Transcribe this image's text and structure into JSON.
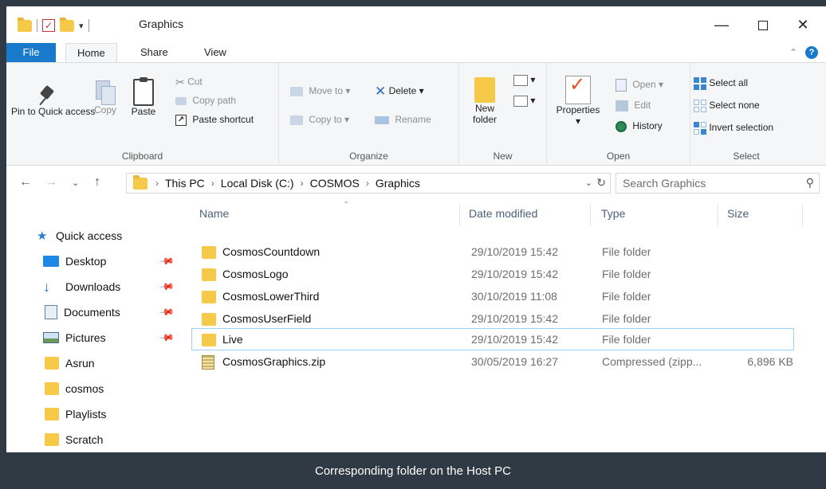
{
  "window": {
    "title": "Graphics"
  },
  "window_controls": {
    "minimize": "—",
    "close": "✕"
  },
  "ribbon_tabs": {
    "file": "File",
    "home": "Home",
    "share": "Share",
    "view": "View"
  },
  "ribbon": {
    "clipboard": {
      "label": "Clipboard",
      "pin": "Pin to Quick access",
      "copy": "Copy",
      "paste": "Paste",
      "cut": "Cut",
      "copy_path": "Copy path",
      "paste_shortcut": "Paste shortcut"
    },
    "organize": {
      "label": "Organize",
      "move_to": "Move to",
      "delete": "Delete",
      "copy_to": "Copy to",
      "rename": "Rename"
    },
    "new": {
      "label": "New",
      "new_folder": "New folder"
    },
    "open": {
      "label": "Open",
      "properties": "Properties",
      "open": "Open",
      "edit": "Edit",
      "history": "History"
    },
    "select": {
      "label": "Select",
      "select_all": "Select all",
      "select_none": "Select none",
      "invert_selection": "Invert selection"
    }
  },
  "address": {
    "breadcrumbs": [
      "This PC",
      "Local Disk (C:)",
      "COSMOS",
      "Graphics"
    ]
  },
  "search": {
    "placeholder": "Search Graphics"
  },
  "nav": {
    "quick_access": "Quick access",
    "items": [
      {
        "label": "Desktop",
        "icon": "desktop-icon",
        "pinned": true
      },
      {
        "label": "Downloads",
        "icon": "downloads-icon",
        "pinned": true
      },
      {
        "label": "Documents",
        "icon": "documents-icon",
        "pinned": true
      },
      {
        "label": "Pictures",
        "icon": "pictures-icon",
        "pinned": true
      },
      {
        "label": "Asrun",
        "icon": "folder-icon",
        "pinned": false
      },
      {
        "label": "cosmos",
        "icon": "folder-icon",
        "pinned": false
      },
      {
        "label": "Playlists",
        "icon": "folder-icon",
        "pinned": false
      },
      {
        "label": "Scratch",
        "icon": "folder-icon",
        "pinned": false
      }
    ]
  },
  "columns": {
    "name": "Name",
    "date": "Date modified",
    "type": "Type",
    "size": "Size"
  },
  "files": [
    {
      "name": "CosmosCountdown",
      "date": "29/10/2019 15:42",
      "type": "File folder",
      "size": "",
      "icon": "folder-icon"
    },
    {
      "name": "CosmosLogo",
      "date": "29/10/2019 15:42",
      "type": "File folder",
      "size": "",
      "icon": "folder-icon"
    },
    {
      "name": "CosmosLowerThird",
      "date": "30/10/2019 11:08",
      "type": "File folder",
      "size": "",
      "icon": "folder-icon"
    },
    {
      "name": "CosmosUserField",
      "date": "29/10/2019 15:42",
      "type": "File folder",
      "size": "",
      "icon": "folder-icon"
    },
    {
      "name": "Live",
      "date": "29/10/2019 15:42",
      "type": "File folder",
      "size": "",
      "icon": "folder-icon",
      "selected": true
    },
    {
      "name": "CosmosGraphics.zip",
      "date": "30/05/2019 16:27",
      "type": "Compressed (zipp...",
      "size": "6,896 KB",
      "icon": "zip-icon"
    }
  ],
  "caption": "Corresponding folder on the Host PC",
  "colors": {
    "accent": "#1979ca",
    "folder": "#f7c948",
    "frame": "#2f3a45",
    "selection_border": "#99d1ff"
  }
}
